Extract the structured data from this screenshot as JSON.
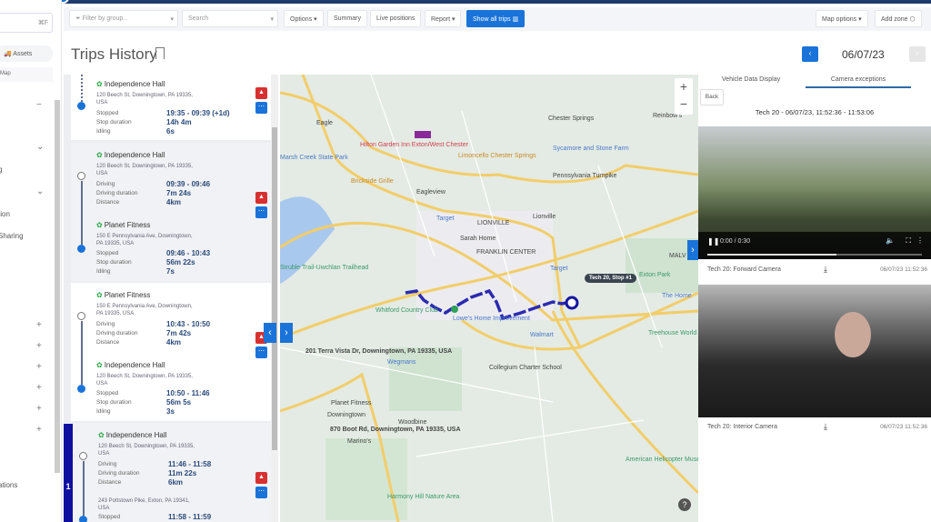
{
  "sidebar": {
    "search_shortcut": "⌘F",
    "assets_label": "Assets",
    "map_label": "Map",
    "items": [
      "g",
      "tion",
      "Sharing",
      "ations",
      "t"
    ]
  },
  "toolbar": {
    "filter_placeholder": "Filter by group..",
    "search_placeholder": "Search",
    "options": "Options",
    "summary": "Summary",
    "live_positions": "Live positions",
    "report": "Report",
    "show_all_trips": "Show all trips",
    "map_options": "Map options",
    "add_zone": "Add zone"
  },
  "header": {
    "title": "Trips History",
    "date": "06/07/23"
  },
  "trips": [
    {
      "place": "Independence Hall",
      "addr": "120 Beech St, Downingtown, PA 19335, USA",
      "rows": [
        [
          "Stopped",
          "19:35 - 09:39 (+1d)"
        ],
        [
          "Stop duration",
          "14h 4m"
        ],
        [
          "Idling",
          "6s"
        ]
      ]
    },
    {
      "start": "Independence Hall",
      "start_addr": "120 Beech St, Downingtown, PA 19335, USA",
      "drive": [
        [
          "Driving",
          "09:39 - 09:46"
        ],
        [
          "Driving duration",
          "7m 24s"
        ],
        [
          "Distance",
          "4km"
        ]
      ],
      "end": "Planet Fitness",
      "end_addr": "150 E Pennsylvania Ave, Downingtown, PA 19335, USA",
      "stop": [
        [
          "Stopped",
          "09:46 - 10:43"
        ],
        [
          "Stop duration",
          "56m 22s"
        ],
        [
          "Idling",
          "7s"
        ]
      ]
    },
    {
      "start": "Planet Fitness",
      "start_addr": "150 E Pennsylvania Ave, Downingtown, PA 19335, USA",
      "drive": [
        [
          "Driving",
          "10:43 - 10:50"
        ],
        [
          "Driving duration",
          "7m 42s"
        ],
        [
          "Distance",
          "4km"
        ]
      ],
      "end": "Independence Hall",
      "end_addr": "120 Beech St, Downingtown, PA 19335, USA",
      "stop": [
        [
          "Stopped",
          "10:50 - 11:46"
        ],
        [
          "Stop duration",
          "56m 5s"
        ],
        [
          "Idling",
          "3s"
        ]
      ]
    },
    {
      "index": "1",
      "start": "Independence Hall",
      "start_addr": "120 Beech St, Downingtown, PA 19335, USA",
      "drive": [
        [
          "Driving",
          "11:46 - 11:58"
        ],
        [
          "Driving duration",
          "11m 22s"
        ],
        [
          "Distance",
          "6km"
        ]
      ],
      "end_addr": "243 Pottstown Pike, Exton, PA 19341, USA",
      "stop": [
        [
          "Stopped",
          "11:58 - 11:59"
        ]
      ]
    }
  ],
  "map": {
    "labels": [
      "Eagle",
      "Hilton Garden Inn Exton/West Chester",
      "Marsh Creek State Park",
      "Brickside Grille",
      "Eagleview",
      "Limoncello Chester Springs",
      "Chester Springs",
      "Sycamore and Stone Farm",
      "Reinbow's",
      "Lionville",
      "LIONVILLE",
      "Target",
      "Sarah Home",
      "FRANKLIN CENTER",
      "Struble Trail-Uwchlan Trailhead",
      "Target",
      "Exton Park",
      "The Home",
      "MALV",
      "Whitford Country Club",
      "Lowe's Home Improvement",
      "Walmart",
      "Treehouse World",
      "201 Terra Vista Dr, Downingtown, PA 19335, USA",
      "Wegmans",
      "Collegium Charter School",
      "Planet Fitness",
      "Downingtown",
      "Woodbine",
      "870 Boot Rd, Downingtown, PA 19335, USA",
      "Marino's",
      "Harmony Hill Nature Area",
      "American Helicopter Museum & Education",
      "Pennsylvania Turnpike"
    ],
    "tooltip": "Tech 20, Stop #1",
    "zoom_in": "+",
    "zoom_out": "−",
    "help": "?"
  },
  "right": {
    "tabs": [
      "Vehicle Data Display",
      "Camera exceptions"
    ],
    "back": "Back",
    "title": "Tech 20 - 06/07/23, 11:52:36 - 11:53:06",
    "video_time": "0:00 / 0:30",
    "video_progress": 0.6,
    "cameras": [
      {
        "name": "Tech 20: Forward Camera",
        "time": "06/07/23 11:52:36"
      },
      {
        "name": "Tech 20: Interior Camera",
        "time": "06/07/23 11:52:36"
      }
    ]
  }
}
